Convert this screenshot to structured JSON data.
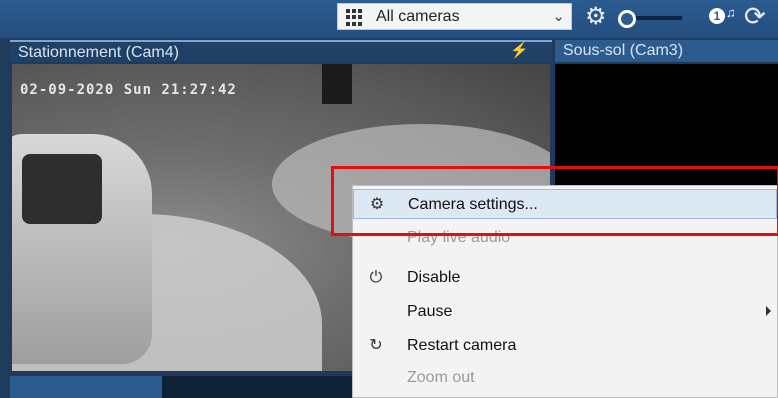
{
  "toolbar": {
    "camera_select": {
      "label": "All cameras",
      "icon": "grid-icon",
      "chevron": "chevron-down-icon"
    },
    "settings_icon": "gear-icon",
    "alert_count": "1",
    "refresh_icon": "refresh-icon"
  },
  "panels": [
    {
      "title": "Stationnement (Cam4)",
      "timestamp": "02-09-2020 Sun 21:27:42",
      "status_icon": "bolt-icon"
    },
    {
      "title": "Sous-sol (Cam3)"
    }
  ],
  "context_menu": {
    "items": [
      {
        "label": "Camera settings...",
        "icon": "gear-icon",
        "state": "highlighted"
      },
      {
        "label": "Play live audio",
        "icon": "",
        "state": "disabled"
      },
      {
        "label": "Disable",
        "icon": "power-icon",
        "state": "enabled"
      },
      {
        "label": "Pause",
        "icon": "",
        "state": "submenu"
      },
      {
        "label": "Restart camera",
        "icon": "restart-icon",
        "state": "enabled"
      },
      {
        "label": "Zoom out",
        "icon": "",
        "state": "disabled"
      }
    ]
  },
  "colors": {
    "toolbar": "#2b5b8f",
    "highlight_box": "#e01010",
    "menu_hover": "#dde8f5"
  }
}
